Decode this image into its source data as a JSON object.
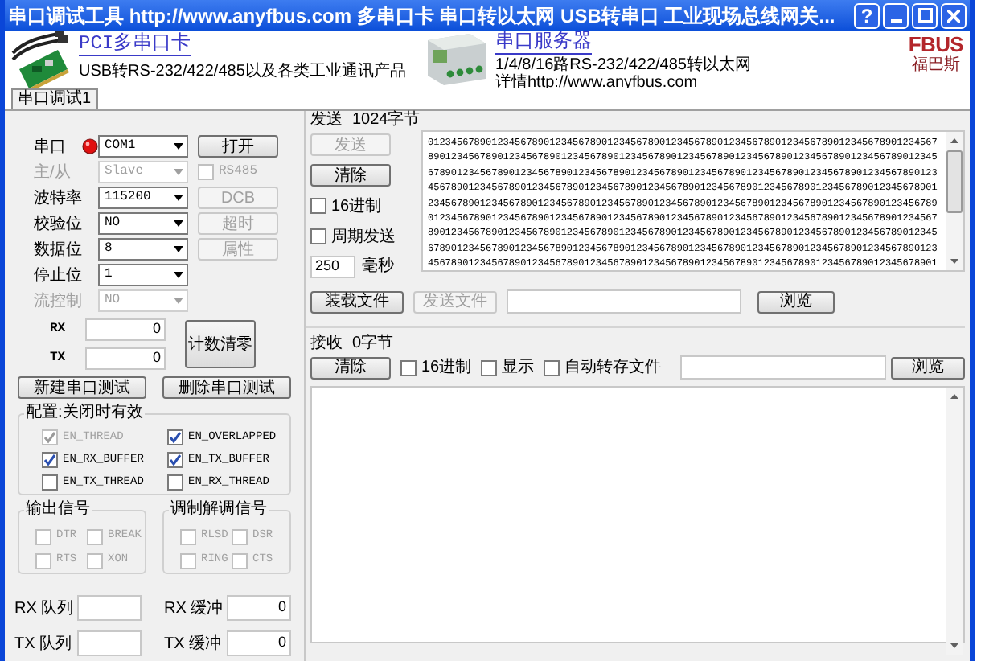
{
  "window": {
    "title": "串口调试工具 http://www.anyfbus.com 多串口卡 串口转以太网 USB转串口 工业现场总线网关...",
    "help_button": "?"
  },
  "banner": {
    "card": {
      "title": "PCI多串口卡",
      "subtitle": "USB转RS-232/422/485以及各类工业通讯产品"
    },
    "server": {
      "title": "串口服务器",
      "lines": [
        "1/4/8/16路RS-232/422/485转以太网",
        "详情http://www.anyfbus.com"
      ]
    },
    "logo": {
      "text": "FBUS",
      "caption": "福巴斯"
    }
  },
  "tabs": [
    {
      "label": "串口调试1",
      "selected": true
    }
  ],
  "port": {
    "open": false,
    "fields": [
      {
        "label": "串口",
        "value": "COM1",
        "disabled": false,
        "side": {
          "kind": "button",
          "label": "打开",
          "disabled": false
        }
      },
      {
        "label": "主/从",
        "value": "Slave",
        "disabled": true,
        "side": {
          "kind": "checkbox",
          "label": "RS485",
          "checked": false,
          "disabled": true
        }
      },
      {
        "label": "波特率",
        "value": "115200",
        "disabled": false,
        "side": {
          "kind": "button",
          "label": "DCB",
          "disabled": true
        }
      },
      {
        "label": "校验位",
        "value": "NO",
        "disabled": false,
        "side": {
          "kind": "button",
          "label": "超时",
          "disabled": true
        }
      },
      {
        "label": "数据位",
        "value": "8",
        "disabled": false,
        "side": {
          "kind": "button",
          "label": "属性",
          "disabled": true
        }
      },
      {
        "label": "停止位",
        "value": "1",
        "disabled": false
      },
      {
        "label": "流控制",
        "value": "NO",
        "disabled": true
      }
    ],
    "counters": [
      {
        "label": "RX",
        "value": "0"
      },
      {
        "label": "TX",
        "value": "0"
      }
    ],
    "reset_button": "计数清零",
    "buttons": [
      "新建串口测试",
      "删除串口测试"
    ]
  },
  "config": {
    "title": "配置:关闭时有效",
    "options": [
      {
        "label": "EN_THREAD",
        "checked": true,
        "disabled": true
      },
      {
        "label": "EN_OVERLAPPED",
        "checked": true,
        "disabled": false
      },
      {
        "label": "EN_RX_BUFFER",
        "checked": true,
        "disabled": false
      },
      {
        "label": "EN_TX_BUFFER",
        "checked": true,
        "disabled": false
      },
      {
        "label": "EN_TX_THREAD",
        "checked": false,
        "disabled": false
      },
      {
        "label": "EN_RX_THREAD",
        "checked": false,
        "disabled": false
      }
    ]
  },
  "signal_groups": [
    {
      "title": "输出信号",
      "items": [
        {
          "label": "DTR",
          "checked": false,
          "disabled": true
        },
        {
          "label": "BREAK",
          "checked": false,
          "disabled": true
        },
        {
          "label": "RTS",
          "checked": false,
          "disabled": true
        },
        {
          "label": "XON",
          "checked": false,
          "disabled": true
        }
      ]
    },
    {
      "title": "调制解调信号",
      "items": [
        {
          "label": "RLSD",
          "checked": false,
          "disabled": true
        },
        {
          "label": "DSR",
          "checked": false,
          "disabled": true
        },
        {
          "label": "RING",
          "checked": false,
          "disabled": true
        },
        {
          "label": "CTS",
          "checked": false,
          "disabled": true
        }
      ]
    }
  ],
  "queues": [
    {
      "label": "RX 队列",
      "buffer_label": "RX 缓冲",
      "buffer_value": "0"
    },
    {
      "label": "TX 队列",
      "buffer_label": "TX 缓冲",
      "buffer_value": "0"
    }
  ],
  "send": {
    "title": "发送",
    "count": "1024字节",
    "send_button": {
      "label": "发送",
      "disabled": true
    },
    "clear_button": "清除",
    "hex": {
      "label": "16进制",
      "checked": false
    },
    "periodic": {
      "label": "周期发送",
      "checked": false
    },
    "interval": "250",
    "unit": "毫秒",
    "lines": [
      "0123456789012345678901234567890123456789012345678901234567890123456789012345678901234567",
      "8901234567890123456789012345678901234567890123456789012345678901234567890123456789012345",
      "6789012345678901234567890123456789012345678901234567890123456789012345678901234567890123",
      "4567890123456789012345678901234567890123456789012345678901234567890123456789012345678901",
      "2345678901234567890123456789012345678901234567890123456789012345678901234567890123456789",
      "0123456789012345678901234567890123456789012345678901234567890123456789012345678901234567",
      "8901234567890123456789012345678901234567890123456789012345678901234567890123456789012345",
      "6789012345678901234567890123456789012345678901234567890123456789012345678901234567890123",
      "4567890123456789012345678901234567890123456789012345678901234567890123456789012345678901"
    ],
    "load_button": "装载文件",
    "send_file_button": {
      "label": "发送文件",
      "disabled": true
    },
    "browse_button": "浏览"
  },
  "receive": {
    "title": "接收",
    "count": "0字节",
    "clear_button": "清除",
    "options": [
      {
        "label": "16进制",
        "checked": false
      },
      {
        "label": "显示",
        "checked": false
      },
      {
        "label": "自动转存文件",
        "checked": false
      }
    ],
    "browse_button": "浏览"
  }
}
